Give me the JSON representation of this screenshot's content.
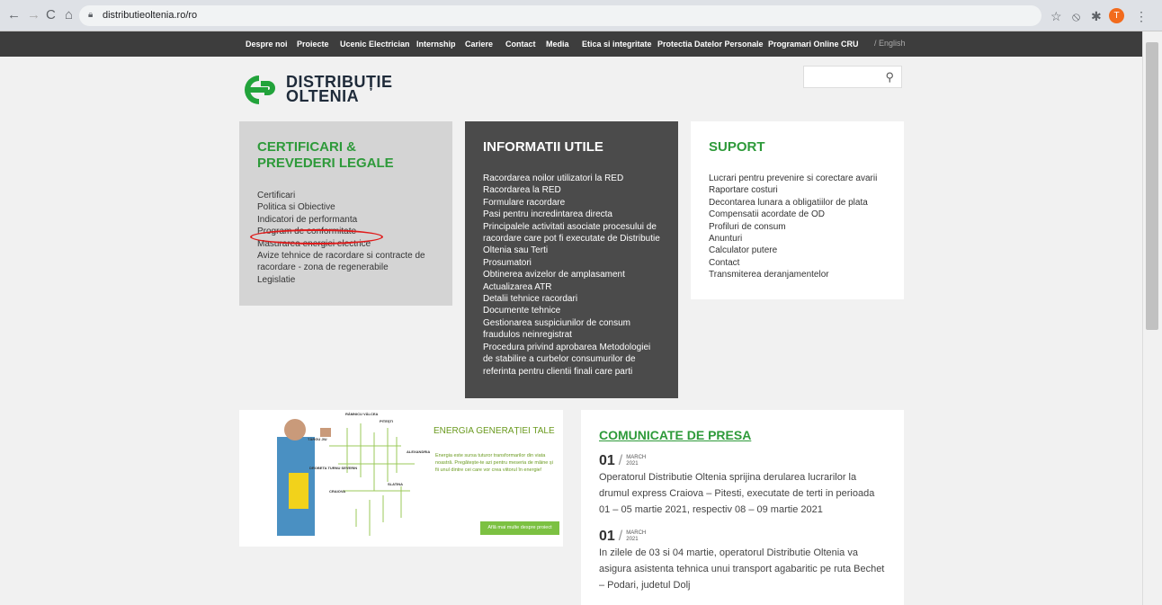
{
  "browser": {
    "url": "distributieoltenia.ro/ro",
    "avatar_letter": "T"
  },
  "topnav": [
    "Despre noi",
    "Proiecte",
    "Ucenic Electrician",
    "Internship",
    "Cariere",
    "Contact",
    "Media",
    "Etica si integritate",
    "Protectia Datelor Personale",
    "Programari Online CRU"
  ],
  "lang": "/ English",
  "logo": {
    "line1": "DISTRIBUȚIE",
    "line2": "OLTENIA",
    "color": "#22a33b"
  },
  "panels": {
    "certificari": {
      "title": "CERTIFICARI & PREVEDERI LEGALE",
      "items": [
        "Certificari",
        "Politica si Obiective",
        "Indicatori de performanta",
        "Program de conformitate",
        "Masurarea energiei electrice",
        "Avize tehnice de racordare si contracte de racordare - zona de regenerabile",
        "Legislatie"
      ]
    },
    "informatii": {
      "title": "INFORMATII UTILE",
      "items": [
        "Racordarea noilor utilizatori la RED",
        "Racordarea la RED",
        "Formulare racordare",
        "Pasi pentru incredintarea directa",
        "Principalele activitati asociate procesului de racordare  care pot fi executate de Distributie Oltenia sau Terti",
        "Prosumatori",
        "Obtinerea avizelor de amplasament",
        "Actualizarea ATR",
        "Detalii tehnice racordari",
        "Documente tehnice",
        "Gestionarea suspiciunilor de consum fraudulos neinregistrat",
        "Procedura privind aprobarea Metodologiei de stabilire a curbelor consumurilor de referinta pentru clientii finali care parti"
      ]
    },
    "suport": {
      "title": "SUPORT",
      "items": [
        "Lucrari pentru prevenire si corectare avarii",
        "Raportare costuri",
        "Decontarea lunara a obligatiilor de plata",
        "Compensatii acordate de OD",
        "Profiluri de consum",
        "Anunturi",
        "Calculator putere",
        "Contact",
        "Transmiterea deranjamentelor"
      ]
    }
  },
  "banner": {
    "title": "ENERGIA GENERAȚIEI TALE",
    "desc": "Energia este sursa tuturor transformarilor din viata noastră. Pregătește-te azi pentru meseria de mâine și fii unul dintre cei care vor crea viitorul în energie!",
    "cta": "Află mai multe despre proiect",
    "cities": [
      "RÂMNICU VÂLCEA",
      "PITEȘTI",
      "TÂRGU JIU",
      "ALEXANDRIA",
      "DROBETA TURNU SEVERIN",
      "SLATINA",
      "CRAIOVA"
    ]
  },
  "press": {
    "title": "COMUNICATE DE PRESA",
    "items": [
      {
        "day": "01",
        "month": "MARCH",
        "year": "2021",
        "text": "Operatorul Distributie Oltenia sprijina derularea lucrarilor la drumul express Craiova – Pitesti, executate de terti in perioada 01 – 05 martie 2021, respectiv 08 – 09 martie 2021"
      },
      {
        "day": "01",
        "month": "MARCH",
        "year": "2021",
        "text": "In zilele de 03 si 04 martie, operatorul Distributie Oltenia va asigura asistenta tehnica unui transport agabaritic pe ruta Bechet – Podari, judetul Dolj"
      }
    ]
  }
}
